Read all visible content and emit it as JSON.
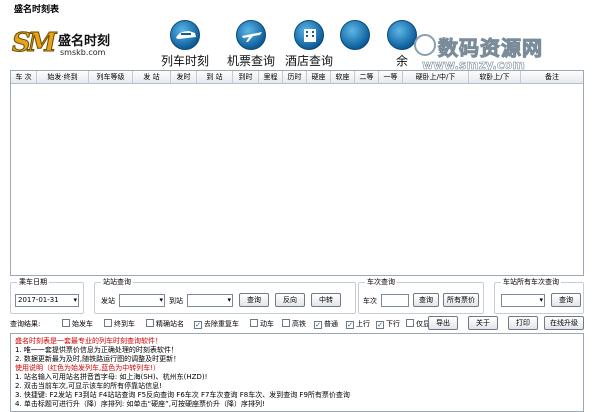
{
  "window": {
    "title": "盛名时刻表"
  },
  "logo": {
    "mark": "SM",
    "name": "盛名时刻",
    "domain": "smskb.com"
  },
  "nav": [
    {
      "label": "列车时刻",
      "icon": "train-icon"
    },
    {
      "label": "机票查询",
      "icon": "plane-icon"
    },
    {
      "label": "酒店查询",
      "icon": "hotel-icon"
    },
    {
      "label": "",
      "icon": "other-icon"
    },
    {
      "label": "余",
      "icon": "other-icon"
    }
  ],
  "watermark": {
    "text": "数码资源网",
    "url": "www.smzy.com"
  },
  "table": {
    "columns": [
      "车 次",
      "始发·终到",
      "列车等级",
      "发 站",
      "发时",
      "到 站",
      "到时",
      "里程",
      "历时",
      "硬座",
      "软座",
      "二等",
      "一等",
      "硬卧上/中/下",
      "软卧上/下",
      "备注"
    ]
  },
  "date_group": {
    "title": "乘车日期",
    "value": "2017-01-31"
  },
  "station_group": {
    "title": "站站查询",
    "from_label": "发站",
    "to_label": "到站",
    "query": "查询",
    "reverse": "反向",
    "transfer": "中转"
  },
  "train_group": {
    "title": "车次查询",
    "label": "车次",
    "query": "查询",
    "all_fares": "所有票价"
  },
  "all_trains_group": {
    "title": "车站所有车次查询",
    "query": "查询"
  },
  "options": {
    "label": "查询结果:",
    "items": [
      {
        "label": "始发车",
        "checked": false
      },
      {
        "label": "终到车",
        "checked": false
      },
      {
        "label": "精确站名",
        "checked": false
      },
      {
        "label": "去除重复车",
        "checked": true
      },
      {
        "label": "动车",
        "checked": false
      },
      {
        "label": "高铁",
        "checked": false
      },
      {
        "label": "普通",
        "checked": true
      },
      {
        "label": "上行",
        "checked": true
      },
      {
        "label": "下行",
        "checked": true
      },
      {
        "label": "仅显示开行",
        "checked": false
      }
    ],
    "export": "导出",
    "about": "关于",
    "print": "打印",
    "upgrade": "在线升级"
  },
  "info": {
    "lines": [
      "盛名时刻表是一套最专业的列车时刻查询软件！",
      "1. 唯一一套提供票价信息为正确处理的时刻表软件！",
      "2. 数据更新最为及时,随铁路运行图的调整及时更新！",
      "使用说明（红色为始发列车,蓝色为中转列车!）",
      "1. 站名输入可用站名拼音首字母: 如上海(SH)、杭州东(HZD)!",
      "2. 双击当前车次,可显示该车的所有停靠站信息!",
      "3. 快捷键: F2发站 F3到站 F4站站查询 F5反向查询 F6车次 F7车次查询 F8车次、发到查询 F9所有票价查询",
      "4. 单击标题可进行升（降）序排列: 如单击“硬座”,可按硬座票价升（降）序排列!"
    ]
  },
  "colors": {
    "accent_blue": "#0e5e9a",
    "header_bg": "#e6e9ee",
    "red": "#d40000",
    "blue": "#1858c0"
  }
}
